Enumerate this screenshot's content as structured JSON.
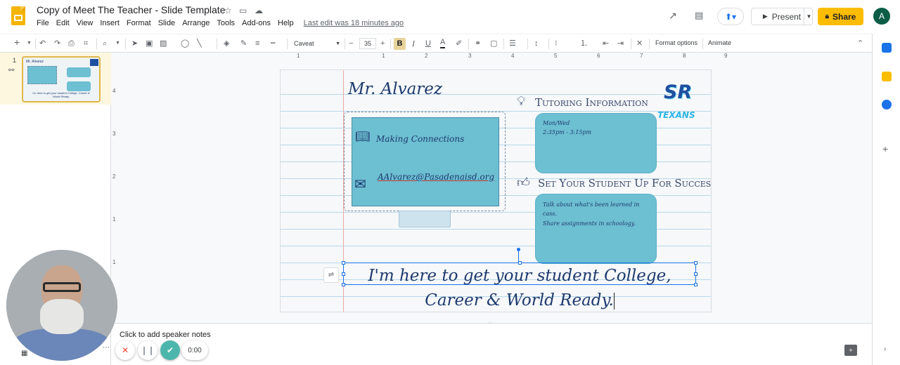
{
  "app": {
    "doc_title": "Copy of Meet The Teacher - Slide Template",
    "menu": [
      "File",
      "Edit",
      "View",
      "Insert",
      "Format",
      "Slide",
      "Arrange",
      "Tools",
      "Add-ons",
      "Help"
    ],
    "last_edit": "Last edit was 18 minutes ago",
    "present_label": "Present",
    "share_label": "Share",
    "avatar_letter": "A"
  },
  "toolbar": {
    "font_name": "Caveat",
    "font_size": "35",
    "bold": "B",
    "italic": "I",
    "underline": "U",
    "text_color": "A",
    "format_options": "Format options",
    "animate": "Animate"
  },
  "filmstrip": {
    "slide_number": "1"
  },
  "rulers": {
    "top": [
      "1",
      "1",
      "2",
      "3",
      "4",
      "5",
      "6",
      "7",
      "8",
      "9"
    ],
    "left": [
      "4",
      "3",
      "2",
      "1",
      "1"
    ]
  },
  "slide": {
    "teacher_name": "Mr. Alvarez",
    "making_connections": "Making Connections",
    "email": "AAlvarez@Pasadenaisd.org",
    "tutoring_title": "Tutoring Information",
    "tutoring_days": "Mon/Wed",
    "tutoring_time": "2:35pm - 3:15pm",
    "success_title": "Set Your Student Up For Success",
    "success_line1": "Talk about what's been learned in",
    "success_line2": "cass.",
    "success_line3": "Share assignments in schoology.",
    "logo_initials": "SR",
    "logo_team": "TEXANS",
    "motto": "I'm here to get your student College, Career & World Ready."
  },
  "thumbnail": {
    "name": "Mr. Alvarez",
    "motto": "I'm here to get your student College, Career & World Ready."
  },
  "notes": {
    "placeholder": "Click to add speaker notes"
  },
  "recorder": {
    "timer": "0:00"
  },
  "colors": {
    "accent_share": "#fbbc04",
    "screen_blue": "#6dbfd2",
    "ink_navy": "#1e3a6e",
    "selection_blue": "#1a73e8",
    "thumb_border": "#e0b84a",
    "check_green": "#4db6ac"
  }
}
